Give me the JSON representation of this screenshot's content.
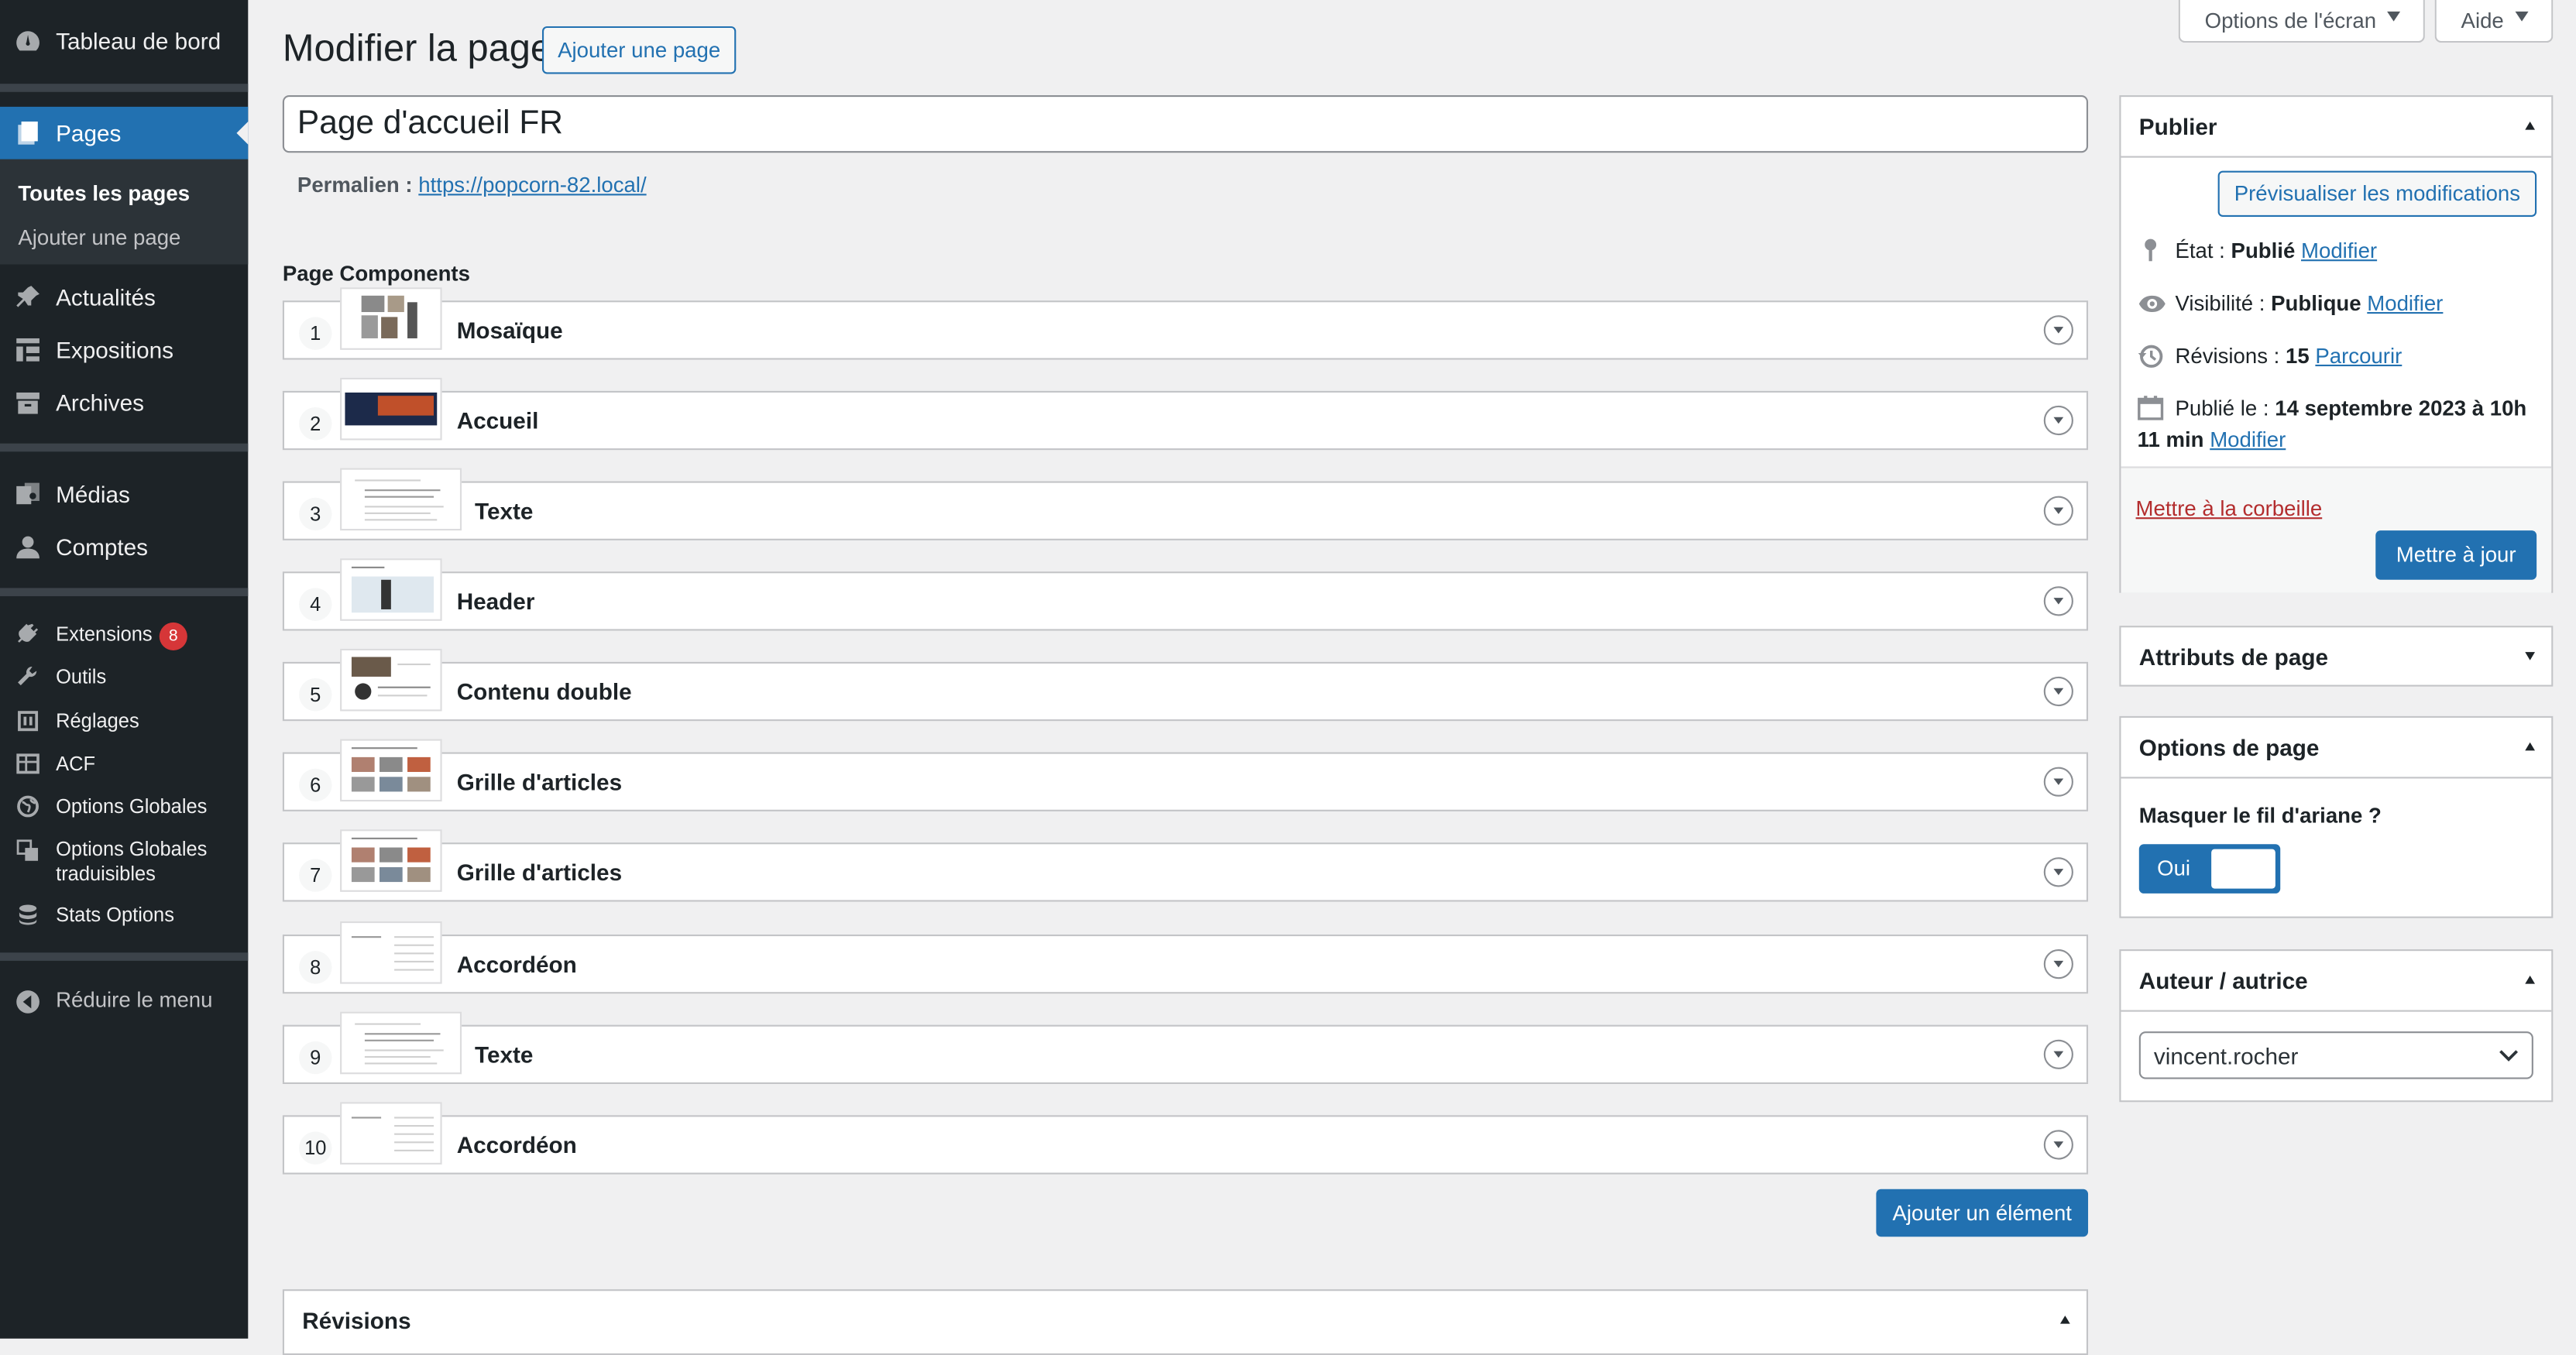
{
  "sidebar": {
    "dashboard": "Tableau de bord",
    "pages": "Pages",
    "sub_all": "Toutes les pages",
    "sub_add": "Ajouter une page",
    "news": "Actualités",
    "expositions": "Expositions",
    "archives": "Archives",
    "media": "Médias",
    "accounts": "Comptes",
    "extensions": "Extensions",
    "extensions_badge": "8",
    "tools": "Outils",
    "settings": "Réglages",
    "acf": "ACF",
    "global_options": "Options Globales",
    "global_options_tr_1": "Options Globales",
    "global_options_tr_2": "traduisibles",
    "stats_options": "Stats Options",
    "collapse": "Réduire le menu"
  },
  "topbar": {
    "screen_options": "Options de l'écran",
    "help": "Aide"
  },
  "header": {
    "title": "Modifier la page",
    "add_page": "Ajouter une page"
  },
  "editor": {
    "page_title": "Page d'accueil FR",
    "permalink_label": "Permalien :",
    "permalink_url": "https://popcorn-82.local/"
  },
  "components": {
    "heading": "Page Components",
    "items": [
      {
        "num": "1",
        "label": "Mosaïque"
      },
      {
        "num": "2",
        "label": "Accueil"
      },
      {
        "num": "3",
        "label": "Texte"
      },
      {
        "num": "4",
        "label": "Header"
      },
      {
        "num": "5",
        "label": "Contenu double"
      },
      {
        "num": "6",
        "label": "Grille d'articles"
      },
      {
        "num": "7",
        "label": "Grille d'articles"
      },
      {
        "num": "8",
        "label": "Accordéon"
      },
      {
        "num": "9",
        "label": "Texte"
      },
      {
        "num": "10",
        "label": "Accordéon"
      }
    ],
    "add_button": "Ajouter un élément"
  },
  "revisions_box": {
    "title": "Révisions"
  },
  "publish": {
    "title": "Publier",
    "preview": "Prévisualiser les modifications",
    "status_label": "État :",
    "status_value": "Publié",
    "visibility_label": "Visibilité :",
    "visibility_value": "Publique",
    "revisions_label": "Révisions :",
    "revisions_value": "15",
    "browse": "Parcourir",
    "published_label": "Publié le :",
    "published_value_1": "14 septembre 2023 à 10h",
    "published_value_2": "11 min",
    "edit": "Modifier",
    "trash": "Mettre à la corbeille",
    "update": "Mettre à jour"
  },
  "page_attributes": {
    "title": "Attributs de page"
  },
  "page_options": {
    "title": "Options de page",
    "breadcrumb_question": "Masquer le fil d'ariane ?",
    "toggle_value": "Oui"
  },
  "author": {
    "title": "Auteur / autrice",
    "value": "vincent.rocher"
  },
  "colors": {
    "sidebar_bg": "#1d2327",
    "accent": "#2271b1",
    "danger": "#b32d2e",
    "badge": "#d63638"
  }
}
